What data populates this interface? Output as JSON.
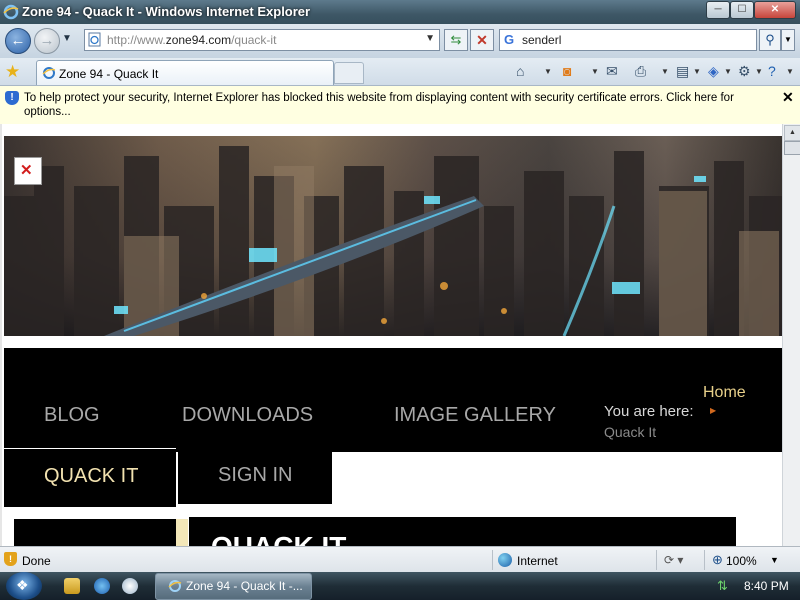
{
  "window": {
    "title": "Zone 94 - Quack It - Windows Internet Explorer",
    "minimize": "─",
    "maximize": "☐",
    "close": "✕"
  },
  "address_bar": {
    "url_prefix": "http://www.",
    "url_domain": "zone94.com",
    "url_path": "/quack-it",
    "search_value": "senderl",
    "search_placeholder": "Google"
  },
  "tab": {
    "label": "Zone 94 - Quack It"
  },
  "info_bar": {
    "message": "To help protect your security, Internet Explorer has blocked this website from displaying content with security certificate errors. Click here for options..."
  },
  "page": {
    "nav": {
      "blog": "BLOG",
      "downloads": "DOWNLOADS",
      "image_gallery": "IMAGE GALLERY",
      "quack_it": "QUACK IT",
      "sign_in": "SIGN IN"
    },
    "breadcrumb": {
      "prefix": "You are here:",
      "home": "Home",
      "current": "Quack It"
    },
    "main_heading": "QUACK IT"
  },
  "status": {
    "text": "Done",
    "zone": "Internet",
    "zoom": "100%"
  },
  "taskbar": {
    "task_label": "Zone 94 - Quack It -...",
    "clock": "8:40 PM"
  },
  "colors": {
    "nav_background": "#000000",
    "nav_active_text": "#f2e2b0",
    "breadcrumb_home": "#e8d08a",
    "infobar_background": "#ffffe1"
  }
}
